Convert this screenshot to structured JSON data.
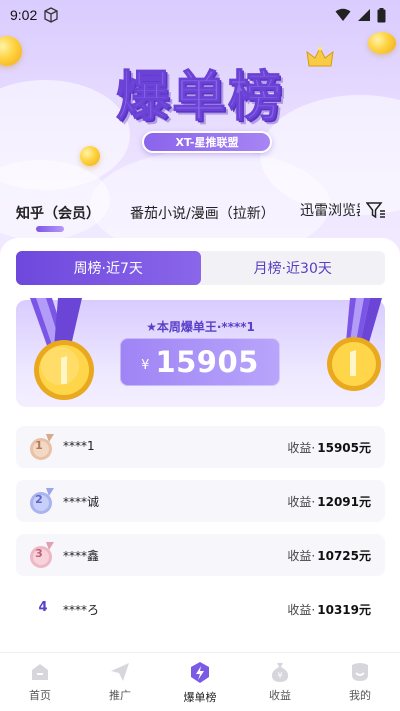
{
  "status_bar": {
    "time": "9:02"
  },
  "hero": {
    "title": "爆单榜",
    "subtitle": "XT-星推联盟"
  },
  "category_tabs": [
    {
      "label": "知乎（会员）"
    },
    {
      "label": "番茄小说/漫画（拉新）"
    },
    {
      "label": "迅雷浏览器"
    }
  ],
  "period_tabs": [
    {
      "label": "周榜·近7天"
    },
    {
      "label": "月榜·近30天"
    }
  ],
  "champion": {
    "label": "★本周爆单王·****1",
    "currency": "¥",
    "amount": "15905"
  },
  "ranking": [
    {
      "rank": "1",
      "name": "****1",
      "earn_label": "收益·",
      "earn_value": "15905元"
    },
    {
      "rank": "2",
      "name": "****诚",
      "earn_label": "收益·",
      "earn_value": "12091元"
    },
    {
      "rank": "3",
      "name": "****鑫",
      "earn_label": "收益·",
      "earn_value": "10725元"
    },
    {
      "rank": "4",
      "name": "****ろ",
      "earn_label": "收益·",
      "earn_value": "10319元"
    }
  ],
  "bottom_nav": [
    {
      "label": "首页",
      "icon": "home-icon"
    },
    {
      "label": "推广",
      "icon": "send-icon"
    },
    {
      "label": "爆单榜",
      "icon": "bolt-icon"
    },
    {
      "label": "收益",
      "icon": "money-bag-icon"
    },
    {
      "label": "我的",
      "icon": "profile-icon"
    }
  ],
  "colors": {
    "accent": "#6e48dc",
    "accent_light": "#b9a5fb",
    "gold": "#f5c23a"
  }
}
